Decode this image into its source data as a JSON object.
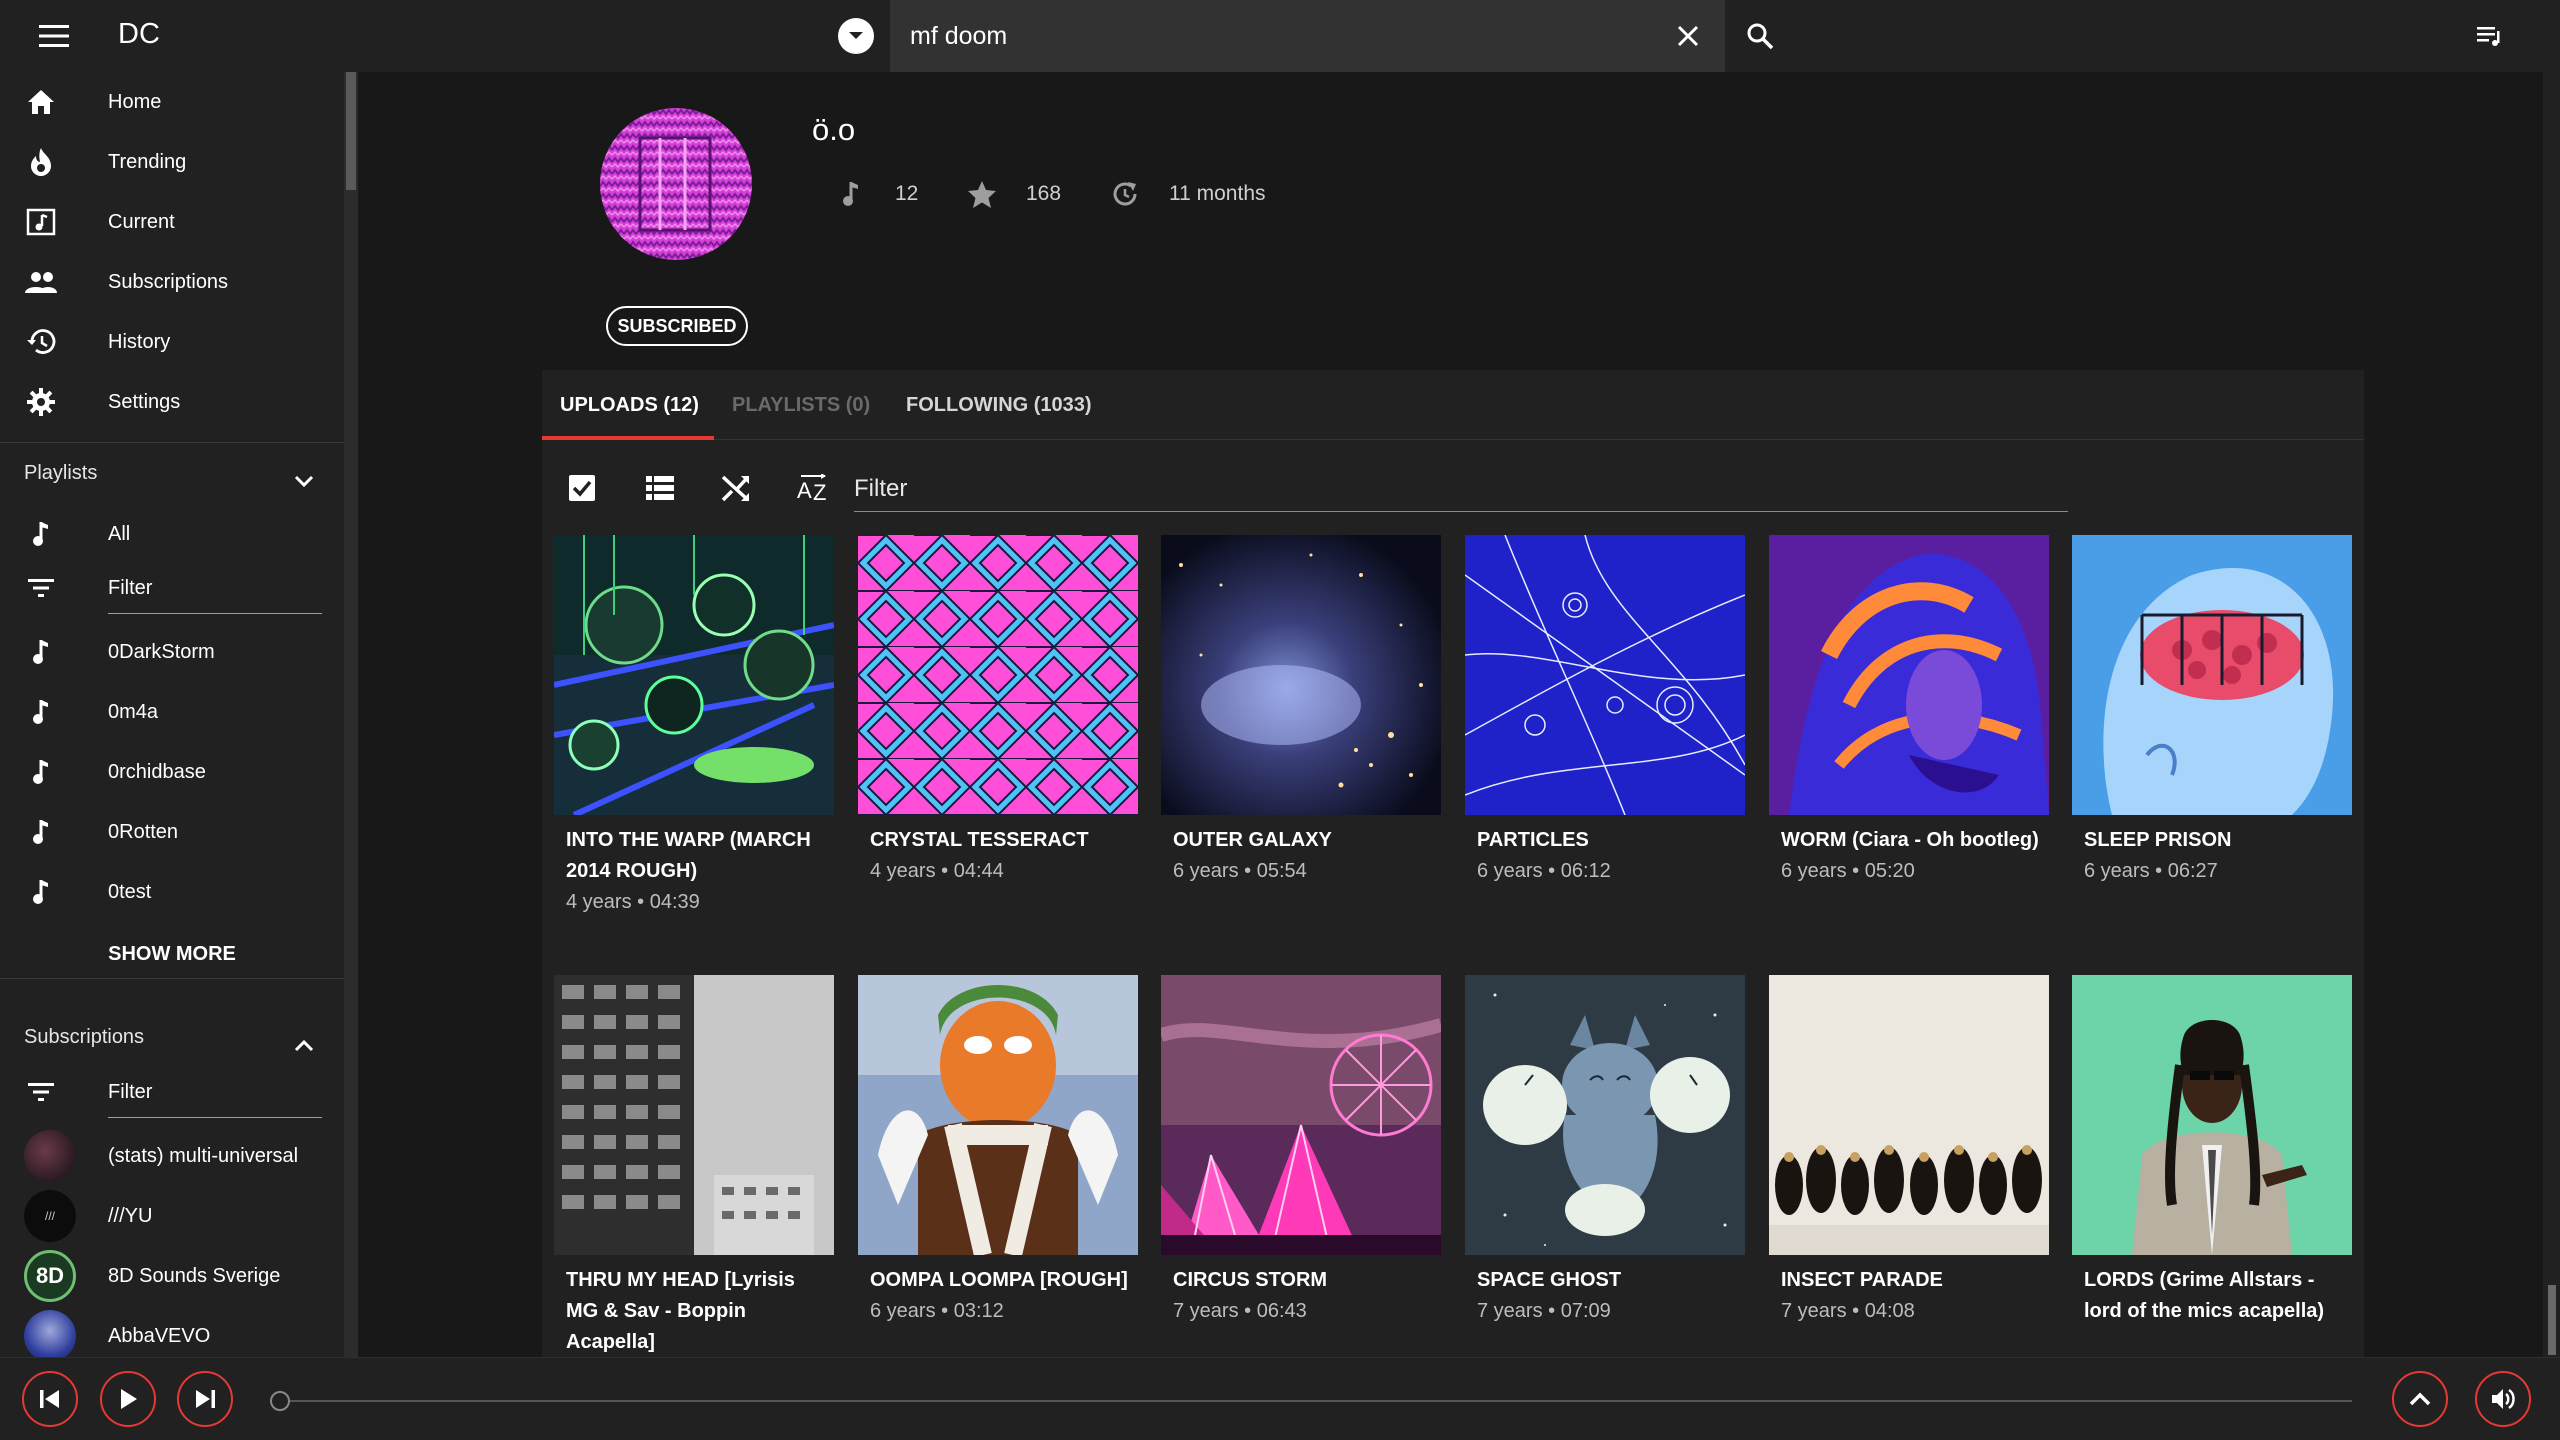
{
  "app": {
    "title": "DC"
  },
  "search": {
    "query": "mf doom",
    "placeholder": "Search"
  },
  "nav": [
    {
      "label": "Home",
      "icon": "home-icon"
    },
    {
      "label": "Trending",
      "icon": "flame-icon"
    },
    {
      "label": "Current",
      "icon": "music-box-icon"
    },
    {
      "label": "Subscriptions",
      "icon": "people-icon"
    },
    {
      "label": "History",
      "icon": "history-icon"
    },
    {
      "label": "Settings",
      "icon": "gear-icon"
    }
  ],
  "playlists": {
    "title": "Playlists",
    "all_label": "All",
    "filter_label": "Filter",
    "items": [
      "0DarkStorm",
      "0m4a",
      "0rchidbase",
      "0Rotten",
      "0test"
    ],
    "show_more": "SHOW MORE"
  },
  "subscriptions": {
    "title": "Subscriptions",
    "filter_label": "Filter",
    "items": [
      "(stats) multi-universal",
      "///YU",
      "8D Sounds Sverige",
      "AbbaVEVO"
    ],
    "avatar_text_8d": "8D",
    "avatar_text_yu": "///"
  },
  "channel": {
    "name": "ö.o",
    "tracks": "12",
    "favorites": "168",
    "updated": "11 months",
    "subscribed_label": "SUBSCRIBED"
  },
  "tabs": [
    {
      "label": "UPLOADS (12)",
      "active": true
    },
    {
      "label": "PLAYLISTS (0)",
      "active": false
    },
    {
      "label": "FOLLOWING (1033)",
      "active": false
    }
  ],
  "toolbar": {
    "filter_placeholder": "Filter"
  },
  "tracks": [
    {
      "title": "INTO THE WARP (MARCH 2014 ROUGH)",
      "meta": "4 years • 04:39"
    },
    {
      "title": "CRYSTAL TESSERACT",
      "meta": "4 years • 04:44"
    },
    {
      "title": "OUTER GALAXY",
      "meta": "6 years • 05:54"
    },
    {
      "title": "PARTICLES",
      "meta": "6 years • 06:12"
    },
    {
      "title": "WORM (Ciara - Oh bootleg)",
      "meta": "6 years • 05:20"
    },
    {
      "title": "SLEEP PRISON",
      "meta": "6 years • 06:27"
    },
    {
      "title": "THRU MY HEAD [Lyrisis MG & Sav - Boppin Acapella]",
      "meta": ""
    },
    {
      "title": "OOMPA LOOMPA [ROUGH]",
      "meta": "6 years • 03:12"
    },
    {
      "title": "CIRCUS STORM",
      "meta": "7 years • 06:43"
    },
    {
      "title": "SPACE GHOST",
      "meta": "7 years • 07:09"
    },
    {
      "title": "INSECT PARADE",
      "meta": "7 years • 04:08"
    },
    {
      "title": "LORDS (Grime Allstars - lord of the mics acapella)",
      "meta": ""
    }
  ],
  "player": {
    "progress": 0
  },
  "colors": {
    "accent": "#e53935",
    "background": "#181818",
    "panel": "#212121"
  }
}
